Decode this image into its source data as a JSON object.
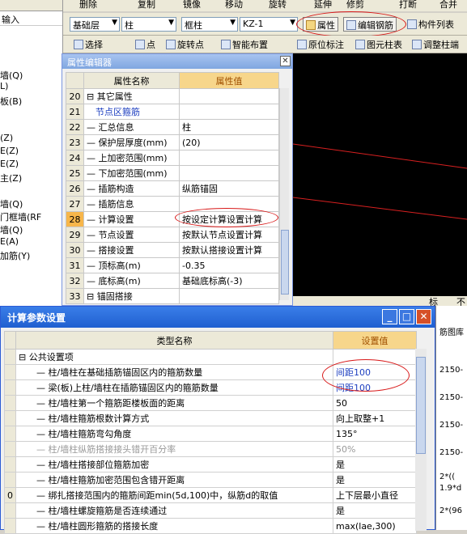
{
  "toolbar": {
    "row1": [
      "删除",
      "复制",
      "镜像",
      "移动",
      "旋转",
      "延伸",
      "修剪",
      "打断",
      "合并"
    ],
    "floor": "基础层",
    "category": "柱",
    "type": "框柱",
    "element": "KZ-1",
    "prop_button": "属性",
    "edit_rebar_button": "编辑钢筋",
    "component_list": "构件列表",
    "row3": [
      "选择",
      "点",
      "旋转点",
      "智能布置",
      "原位标注",
      "图元柱表",
      "调整柱端"
    ]
  },
  "left_panel": {
    "input_label": "输入",
    "items": [
      "墙(Q)",
      "L)",
      "板(B)",
      "(Z)",
      "E(Z)",
      "E(Z)",
      "主(Z)",
      "墙(Q)",
      "门框墙(RF",
      "墙(Q)",
      "E(A)",
      "加筋(Y)"
    ]
  },
  "prop_editor": {
    "title": "属性编辑器",
    "col_name": "属性名称",
    "col_value": "属性值",
    "rows": [
      {
        "no": "20",
        "name": "其它属性",
        "value": "",
        "group": true
      },
      {
        "no": "21",
        "name": "节点区箍筋",
        "value": "",
        "blue": true
      },
      {
        "no": "22",
        "name": "汇总信息",
        "value": "柱"
      },
      {
        "no": "23",
        "name": "保护层厚度(mm)",
        "value": "(20)"
      },
      {
        "no": "24",
        "name": "上加密范围(mm)",
        "value": ""
      },
      {
        "no": "25",
        "name": "下加密范围(mm)",
        "value": ""
      },
      {
        "no": "26",
        "name": "插筋构造",
        "value": "纵筋锚固"
      },
      {
        "no": "27",
        "name": "插筋信息",
        "value": ""
      },
      {
        "no": "28",
        "name": "计算设置",
        "value": "按设定计算设置计算",
        "selected": true
      },
      {
        "no": "29",
        "name": "节点设置",
        "value": "按默认节点设置计算"
      },
      {
        "no": "30",
        "name": "搭接设置",
        "value": "按默认搭接设置计算"
      },
      {
        "no": "31",
        "name": "顶标高(m)",
        "value": "-0.35"
      },
      {
        "no": "32",
        "name": "底标高(m)",
        "value": "基础底标高(-3)"
      },
      {
        "no": "33",
        "name": "锚固搭接",
        "value": "",
        "group": true
      }
    ]
  },
  "calc_dialog": {
    "title": "计算参数设置",
    "col_name": "类型名称",
    "col_value": "设置值",
    "rows": [
      {
        "name": "公共设置项",
        "value": "",
        "group": true
      },
      {
        "name": "柱/墙柱在基础插筋锚固区内的箍筋数量",
        "value": "间距100",
        "blue": true
      },
      {
        "name": "梁(板)上柱/墙柱在插筋锚固区内的箍筋数量",
        "value": "间距100",
        "blue": true
      },
      {
        "name": "柱/墙柱第一个箍筋距楼板面的距离",
        "value": "50"
      },
      {
        "name": "柱/墙柱箍筋根数计算方式",
        "value": "向上取整+1"
      },
      {
        "name": "柱/墙柱箍筋弯勾角度",
        "value": "135°"
      },
      {
        "name": "柱/墙柱纵筋搭接接头错开百分率",
        "value": "50%",
        "grey": true
      },
      {
        "name": "柱/墙柱搭接部位箍筋加密",
        "value": "是"
      },
      {
        "name": "柱/墙柱箍筋加密范围包含错开距离",
        "value": "是"
      },
      {
        "name": "绑扎搭接范围内的箍筋间距min(5d,100)中，纵筋d的取值",
        "value": "上下层最小直径",
        "no": "0"
      },
      {
        "name": "柱/墙柱螺旋箍筋是否连续通过",
        "value": "是"
      },
      {
        "name": "柱/墙柱圆形箍筋的搭接长度",
        "value": "max(lae,300)"
      }
    ]
  },
  "right_panel": {
    "header": "筋图库",
    "items": [
      "2150-",
      "2150-",
      "2150-",
      "2150-",
      "2*((",
      "1.9*d",
      "2*(96"
    ]
  },
  "canvas_tabs": [
    "标",
    "不"
  ]
}
